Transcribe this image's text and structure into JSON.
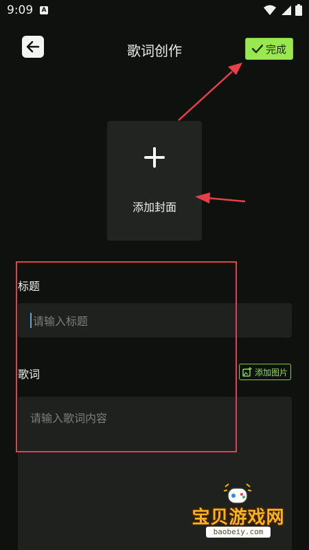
{
  "status_bar": {
    "time": "9:09",
    "notification_icon": "A"
  },
  "header": {
    "title": "歌词创作",
    "back_icon": "arrow-left-icon",
    "done_label": "完成"
  },
  "cover": {
    "add_label": "添加封面",
    "plus_icon": "plus-icon"
  },
  "title_field": {
    "label": "标题",
    "placeholder": "请输入标题"
  },
  "lyrics_field": {
    "label": "歌词",
    "placeholder": "请输入歌词内容",
    "add_image_label": "添加图片"
  },
  "watermark": {
    "text": "宝贝游戏网",
    "url": "baobeiy.com"
  },
  "colors": {
    "background": "#0f110f",
    "accent": "#99e84f",
    "annotation": "#e8404a"
  }
}
